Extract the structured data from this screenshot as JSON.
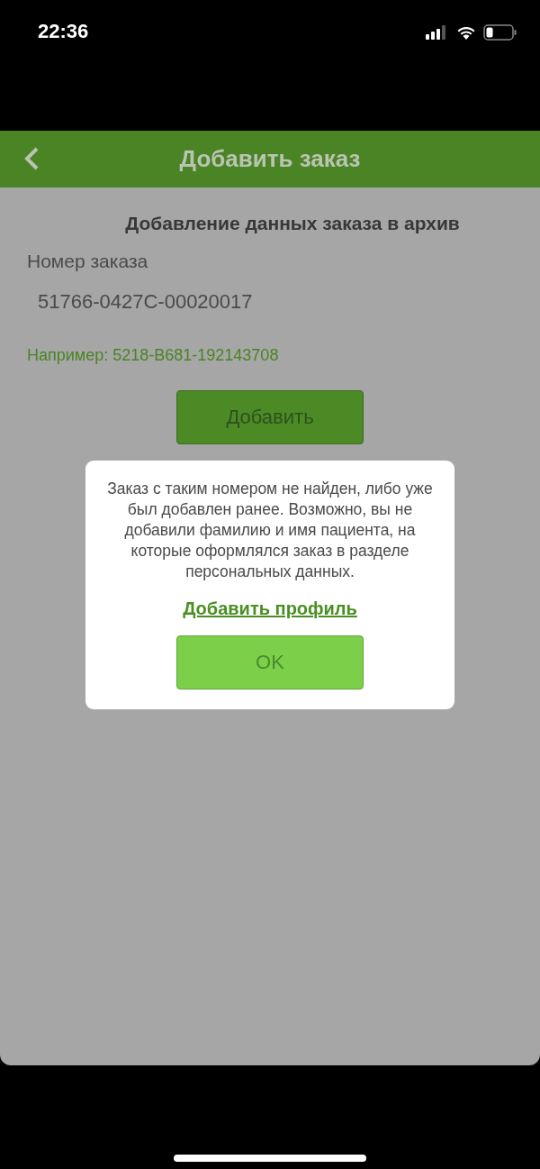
{
  "status_bar": {
    "time": "22:36"
  },
  "header": {
    "title": "Добавить заказ"
  },
  "form": {
    "heading": "Добавление данных заказа в архив",
    "field_label": "Номер заказа",
    "field_value": "51766-0427C-00020017",
    "hint": "Например: 5218-B681-192143708",
    "button": "Добавить"
  },
  "dialog": {
    "message": "Заказ с таким номером не найден, либо уже был добавлен ранее. Возможно, вы не добавили фамилию и имя пациента, на которые оформлялся заказ в разделе персональных данных.",
    "link": "Добавить профиль",
    "button": "OK"
  }
}
